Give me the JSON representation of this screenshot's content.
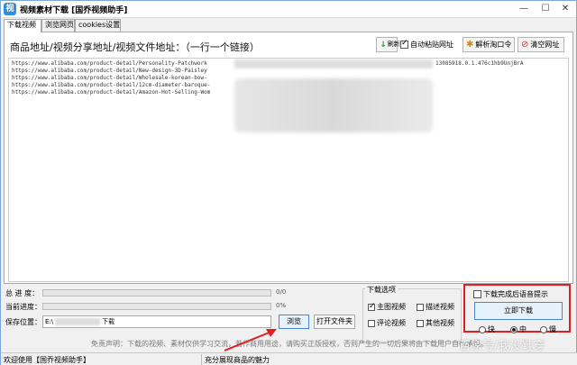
{
  "window": {
    "title": "视频素材下载 [国乔视频助手]",
    "app_icon": "视",
    "minimize": "—",
    "maximize": "☐",
    "close": "✕"
  },
  "tabs": [
    "下载视频",
    "浏览网页",
    "cookies设置"
  ],
  "header": {
    "instruction": "商品地址/视频分享地址/视频文件地址：（一行一个链接）",
    "refresh_label": "刷新",
    "auto_paste_label": "自动粘贴网址",
    "auto_paste_checked": true,
    "parse_label": "解析淘口令",
    "clear_label": "清空网址"
  },
  "urls": [
    "https://www.alibaba.com/product-detail/Personality-Patchwork",
    "https://www.alibaba.com/product-detail/New-design-3D-Paisley",
    "https://www.alibaba.com/product-detail/Wholesale-korean-bow-",
    "https://www.alibaba.com/product-detail/12cm-diameter-baroque-",
    "https://www.alibaba.com/product-detail/Amazon-Hot-Selling-Wom"
  ],
  "url_tail": "13085918.0.1.476c1hb9UnjBrA",
  "progress": {
    "total_label": "总 进 度：",
    "total_value": "0/0",
    "total_fraction": 0,
    "current_label": "当前进度：",
    "current_value": "0%",
    "current_fraction": 0
  },
  "save": {
    "label": "保存位置：",
    "prefix": "E:\\",
    "suffix": "下载"
  },
  "buttons": {
    "browse": "浏览",
    "open_folder": "打开文件夹",
    "download_now": "立即下载"
  },
  "download_options": {
    "title": "下载选项",
    "items": [
      {
        "label": "主图视频",
        "checked": true
      },
      {
        "label": "描述视频",
        "checked": false
      },
      {
        "label": "评论视频",
        "checked": false
      },
      {
        "label": "其他视频",
        "checked": false
      }
    ]
  },
  "voice_prompt": {
    "label": "下载完成后语音提示",
    "checked": false
  },
  "speed": [
    {
      "label": "快",
      "selected": false
    },
    {
      "label": "中",
      "selected": true
    },
    {
      "label": "慢",
      "selected": false
    }
  ],
  "disclaimer": "免责声明：下载的视频、素材仅供学习交流，若作商用用途，请购买正版授权，否则产生的一切后果将由下载用户自行承担。",
  "watermark": "百家号/我没鞋穿",
  "status": {
    "left": "欢迎使用【国乔视频助手】",
    "right": "充分展现商品的魅力"
  },
  "colors": {
    "highlight": "#e02020",
    "arrow": "#e02020",
    "accent_button_border": "#4b86d4"
  }
}
